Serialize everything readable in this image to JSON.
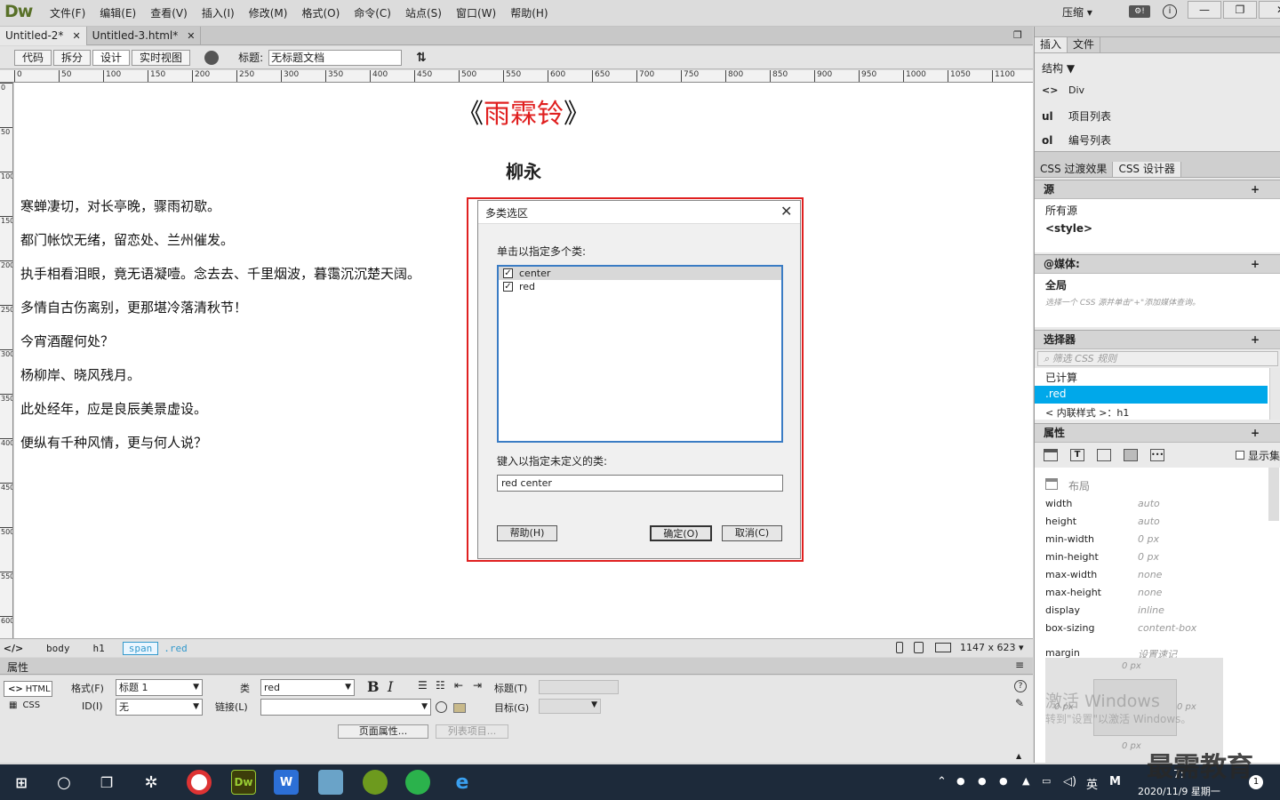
{
  "app": {
    "logo": "Dw",
    "menus": [
      "文件(F)",
      "编辑(E)",
      "查看(V)",
      "插入(I)",
      "修改(M)",
      "格式(O)",
      "命令(C)",
      "站点(S)",
      "窗口(W)",
      "帮助(H)"
    ],
    "compress": "压缩 ▾"
  },
  "doc_tabs": [
    {
      "label": "Untitled-2*"
    },
    {
      "label": "Untitled-3.html*"
    }
  ],
  "toolbar": {
    "views": [
      "代码",
      "拆分",
      "设计",
      "实时视图"
    ],
    "title_label": "标题:",
    "title_value": "无标题文档"
  },
  "ruler": {
    "marks": [
      "0",
      "50",
      "100",
      "150",
      "200",
      "250",
      "300",
      "350",
      "400",
      "450",
      "500",
      "550",
      "600",
      "650",
      "700",
      "750",
      "800",
      "850",
      "900",
      "950",
      "1000",
      "1050",
      "1100"
    ],
    "vmarks": [
      "0",
      "50",
      "100",
      "150",
      "200",
      "250",
      "300",
      "350",
      "400",
      "450",
      "500",
      "550",
      "600"
    ]
  },
  "page": {
    "title_open": "《",
    "title_red": "雨霖铃",
    "title_close": "》",
    "author": "柳永",
    "lines": [
      "寒蝉凄切，对长亭晚，骤雨初歇。",
      "都门帐饮无绪，留恋处、兰州催发。",
      "执手相看泪眼，竟无语凝噎。念去去、千里烟波，暮霭沉沉楚天阔。",
      "多情自古伤离别，更那堪冷落清秋节！",
      "今宵酒醒何处？",
      "杨柳岸、晓风残月。",
      "此处经年，应是良辰美景虚设。",
      "便纵有千种风情，更与何人说？"
    ]
  },
  "dialog": {
    "title": "多类选区",
    "label_select": "单击以指定多个类:",
    "classes": [
      {
        "name": "center",
        "checked": true
      },
      {
        "name": "red",
        "checked": true
      }
    ],
    "label_undefined": "键入以指定未定义的类:",
    "input_value": "red center",
    "help": "帮助(H)",
    "ok": "确定(O)",
    "cancel": "取消(C)"
  },
  "statusbar": {
    "tags": [
      "body",
      "h1",
      "span",
      ".red"
    ],
    "size": "1147 x 623 ▾"
  },
  "properties": {
    "title": "属性",
    "html_btn": "HTML",
    "css_btn": "CSS",
    "format_label": "格式(F)",
    "format_value": "标题 1",
    "class_label": "类",
    "class_value": "red",
    "id_label": "ID(I)",
    "id_value": "无",
    "link_label": "链接(L)",
    "title_t_label": "标题(T)",
    "target_label": "目标(G)",
    "page_props": "页面属性...",
    "list_item": "列表项目..."
  },
  "rpanel": {
    "tabs": [
      "插入",
      "文件"
    ],
    "struct_label": "结构 ▼",
    "insert_items": [
      {
        "icon": "<>",
        "label": "Div"
      },
      {
        "icon": "ul",
        "label": "项目列表"
      },
      {
        "icon": "ol",
        "label": "编号列表"
      }
    ],
    "css_tabs": [
      "CSS 过渡效果",
      "CSS 设计器"
    ],
    "sources_title": "源",
    "sources": [
      "所有源",
      "<style>"
    ],
    "media_title": "@媒体:",
    "media_all": "全局",
    "media_hint": "选择一个 CSS 源并单击\"+\"添加媒体查询。",
    "selectors_title": "选择器",
    "filter_placeholder": "筛选 CSS 规则",
    "selectors": [
      "已计算",
      ".red",
      "< 内联样式 >：h1"
    ],
    "props_title": "属性",
    "show_set": "显示集",
    "layout_label": "布局",
    "props": [
      {
        "k": "width",
        "v": "auto"
      },
      {
        "k": "height",
        "v": "auto"
      },
      {
        "k": "min-width",
        "v": "0 px"
      },
      {
        "k": "min-height",
        "v": "0 px"
      },
      {
        "k": "max-width",
        "v": "none"
      },
      {
        "k": "max-height",
        "v": "none"
      },
      {
        "k": "display",
        "v": "inline"
      },
      {
        "k": "box-sizing",
        "v": "content-box"
      }
    ],
    "margin_label": "margin",
    "margin_value": "设置速记",
    "margin_top": "0 px",
    "margin_left": "0 px",
    "margin_right": "0 px",
    "margin_bottom": "0 px",
    "watermark1": "激活 Windows",
    "watermark2": "转到\"设置\"以激活 Windows。"
  },
  "taskbar": {
    "ime": "英",
    "time": "7:",
    "date": "2020/11/9 星期一",
    "brand": "最需教育"
  }
}
